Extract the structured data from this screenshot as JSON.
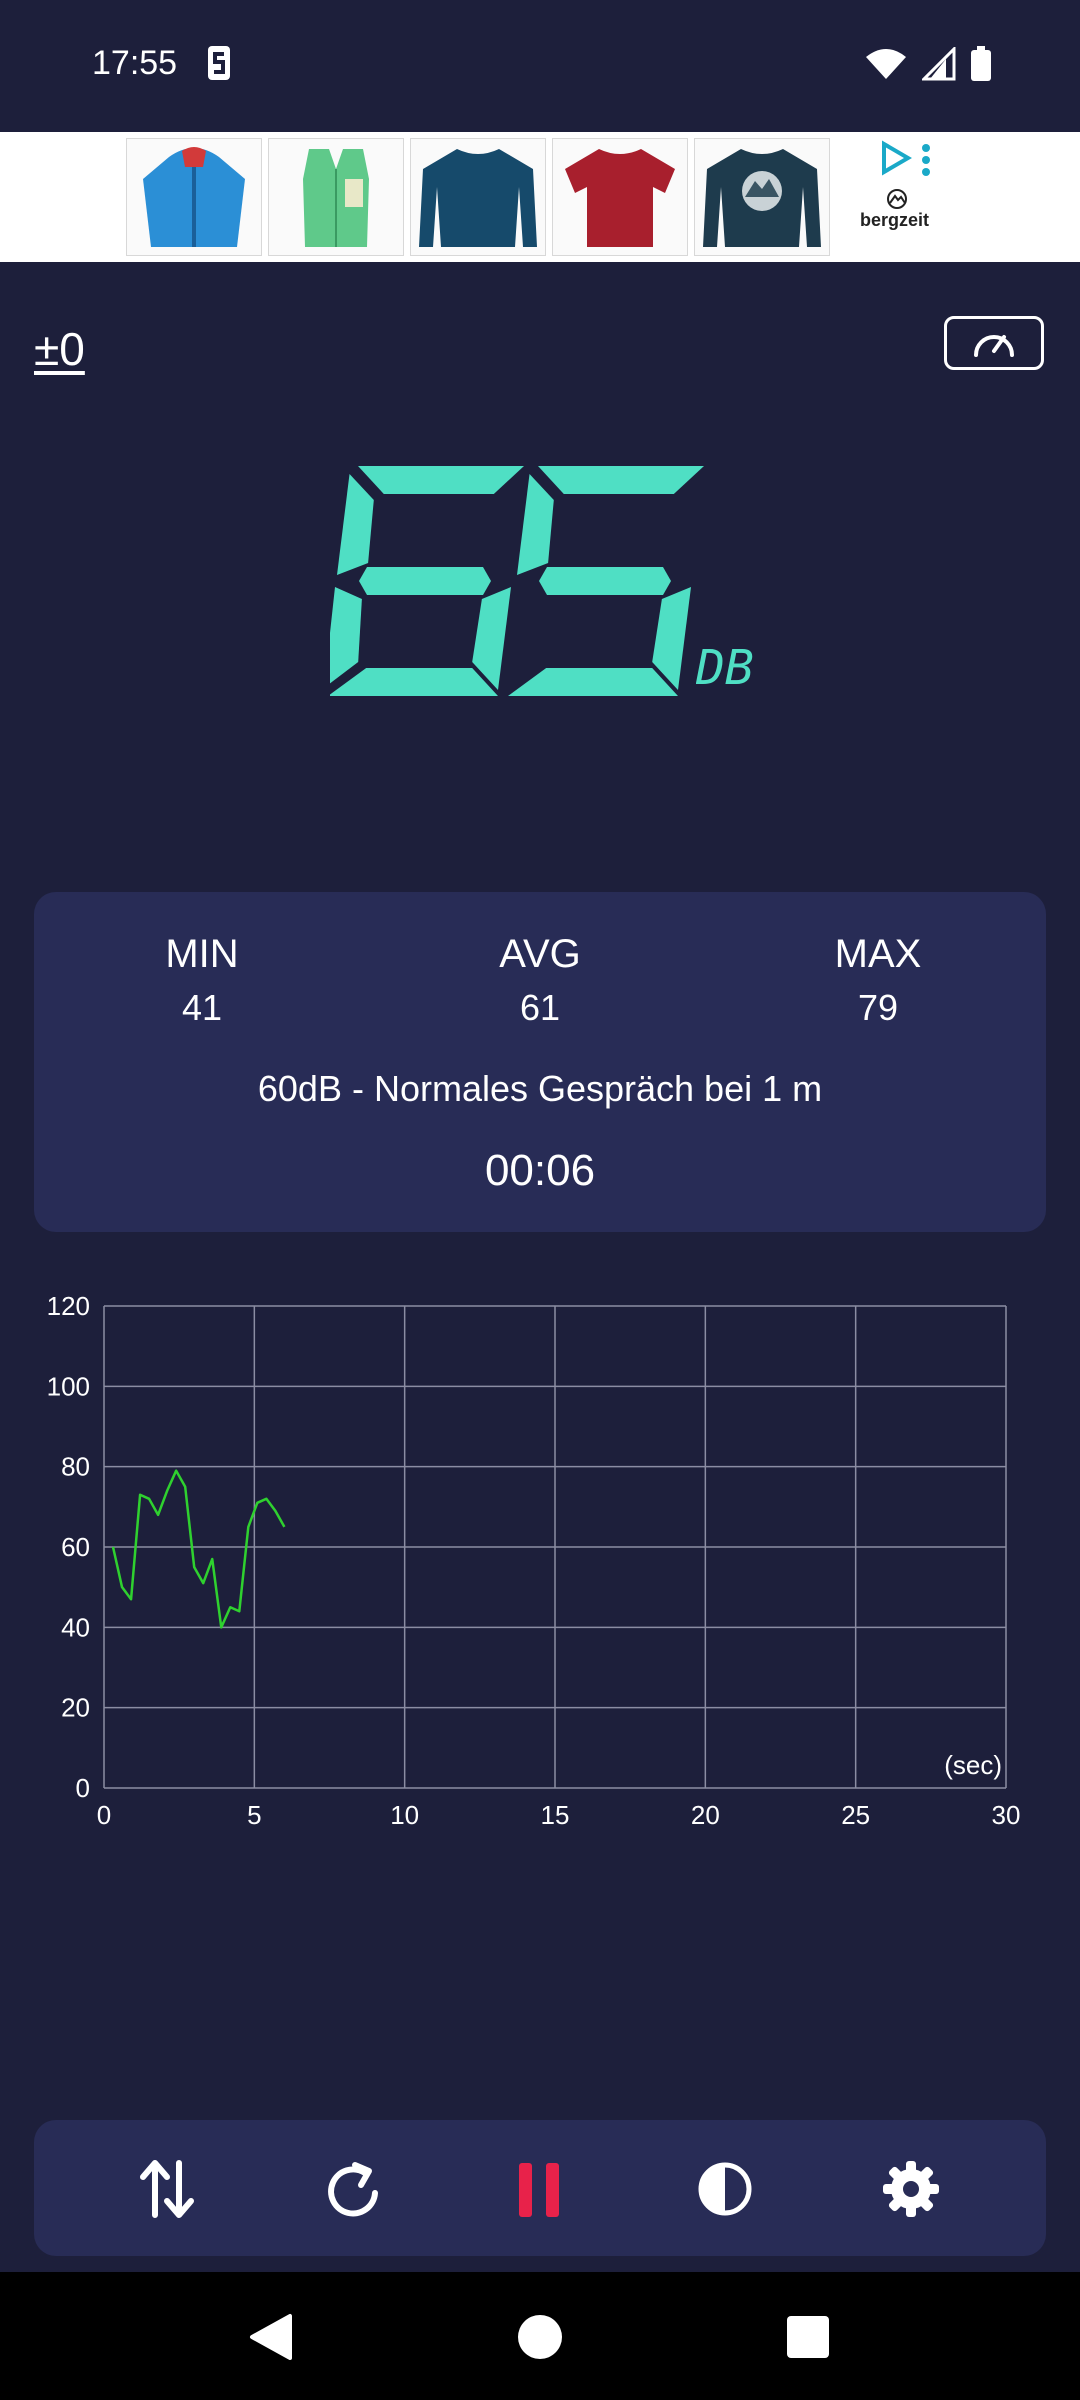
{
  "status": {
    "time": "17:55",
    "icons": [
      "s-notification-icon",
      "wifi-icon",
      "signal-icon",
      "battery-icon"
    ]
  },
  "ad": {
    "brand": "bergzeit",
    "products": [
      "blue-jacket-image",
      "green-vest-image",
      "navy-longsleeve-image",
      "red-tshirt-image",
      "printed-longsleeve-image"
    ]
  },
  "calibration": {
    "offset": "±0"
  },
  "reading": {
    "value": 65,
    "unit": "DB"
  },
  "stats": {
    "min_label": "MIN",
    "min_value": "41",
    "avg_label": "AVG",
    "avg_value": "61",
    "max_label": "MAX",
    "max_value": "79",
    "reference": "60dB - Normales Gespräch bei 1 m",
    "elapsed": "00:06"
  },
  "colors": {
    "background": "#1d1f3b",
    "panel": "#282c56",
    "digits": "#4fdfc4",
    "line": "#2fd12f",
    "pause": "#e8224a"
  },
  "chart_data": {
    "type": "line",
    "title": "",
    "xlabel": "(sec)",
    "ylabel": "",
    "xlim": [
      0,
      30
    ],
    "ylim": [
      0,
      120
    ],
    "x_ticks": [
      0,
      5,
      10,
      15,
      20,
      25,
      30
    ],
    "y_ticks": [
      0,
      20,
      40,
      60,
      80,
      100,
      120
    ],
    "grid": true,
    "series": [
      {
        "x": [
          0.3,
          0.6,
          0.9,
          1.2,
          1.5,
          1.8,
          2.1,
          2.4,
          2.7,
          3.0,
          3.3,
          3.6,
          3.9,
          4.2,
          4.5,
          4.8,
          5.1,
          5.4,
          5.7,
          6.0
        ],
        "y": [
          60,
          50,
          47,
          73,
          72,
          68,
          74,
          79,
          75,
          55,
          51,
          57,
          40,
          45,
          44,
          65,
          71,
          72,
          69,
          65
        ]
      }
    ]
  },
  "controls": [
    "swap-icon",
    "reset-icon",
    "pause-icon",
    "theme-icon",
    "settings-icon"
  ],
  "navigation": [
    "back-icon",
    "home-icon",
    "recents-icon"
  ]
}
